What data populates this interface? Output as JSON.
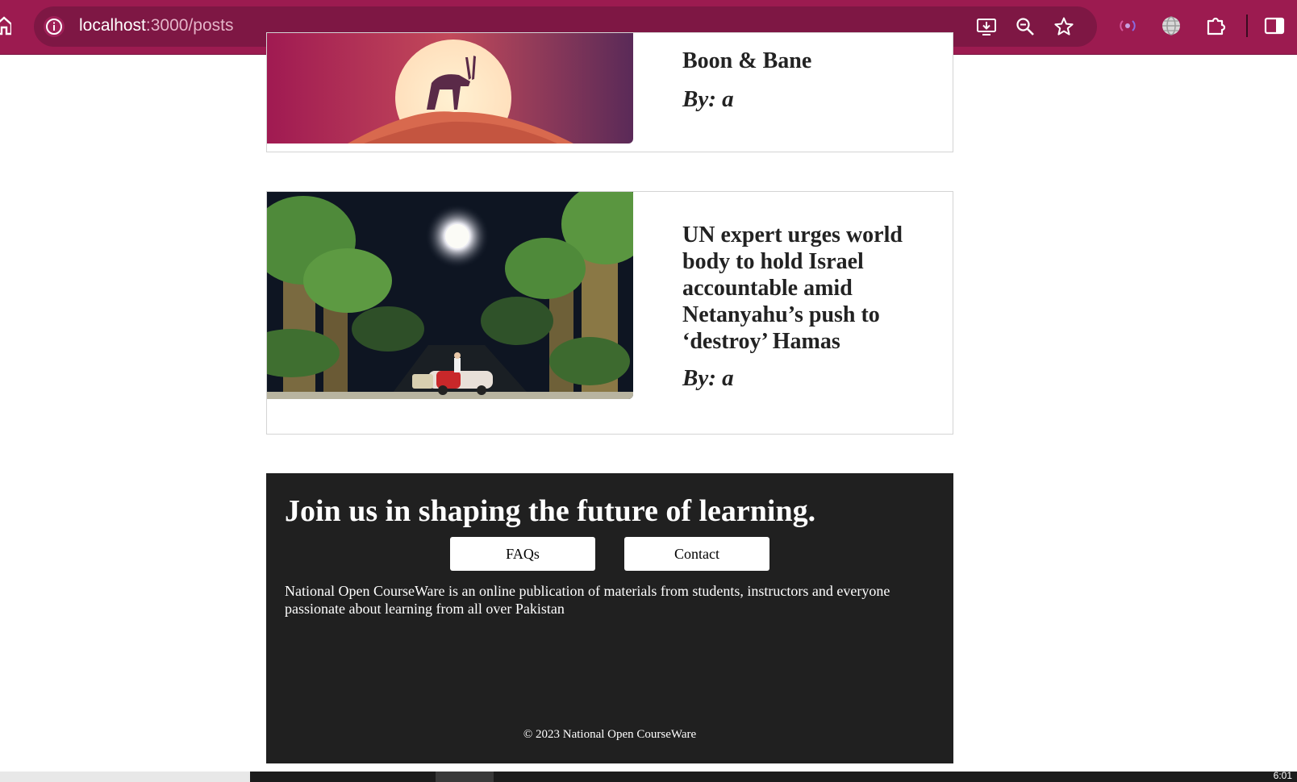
{
  "browser": {
    "url_host": "localhost",
    "url_path": ":3000/posts"
  },
  "posts": [
    {
      "title": "Boon & Bane",
      "author": "By: a",
      "image": "antelope-on-hill-at-sunset"
    },
    {
      "title": "UN expert urges world body to hold Israel accountable amid Netanyahu’s push to ‘destroy’ Hamas",
      "author": "By: a",
      "image": "moonlit-forest-road-with-car"
    }
  ],
  "footer": {
    "heading": "Join us in shaping the future of learning.",
    "faqs_label": "FAQs",
    "contact_label": "Contact",
    "description": "National Open CourseWare is an online publication of materials from students, instructors and everyone passionate about learning from all over Pakistan",
    "copyright": "© 2023 National Open CourseWare"
  },
  "taskbar": {
    "clock": "6:01"
  },
  "colors": {
    "chrome": "#9c1b50",
    "omnibox": "#7e1744",
    "footer_bg": "#202020",
    "text_dark": "#222222"
  }
}
